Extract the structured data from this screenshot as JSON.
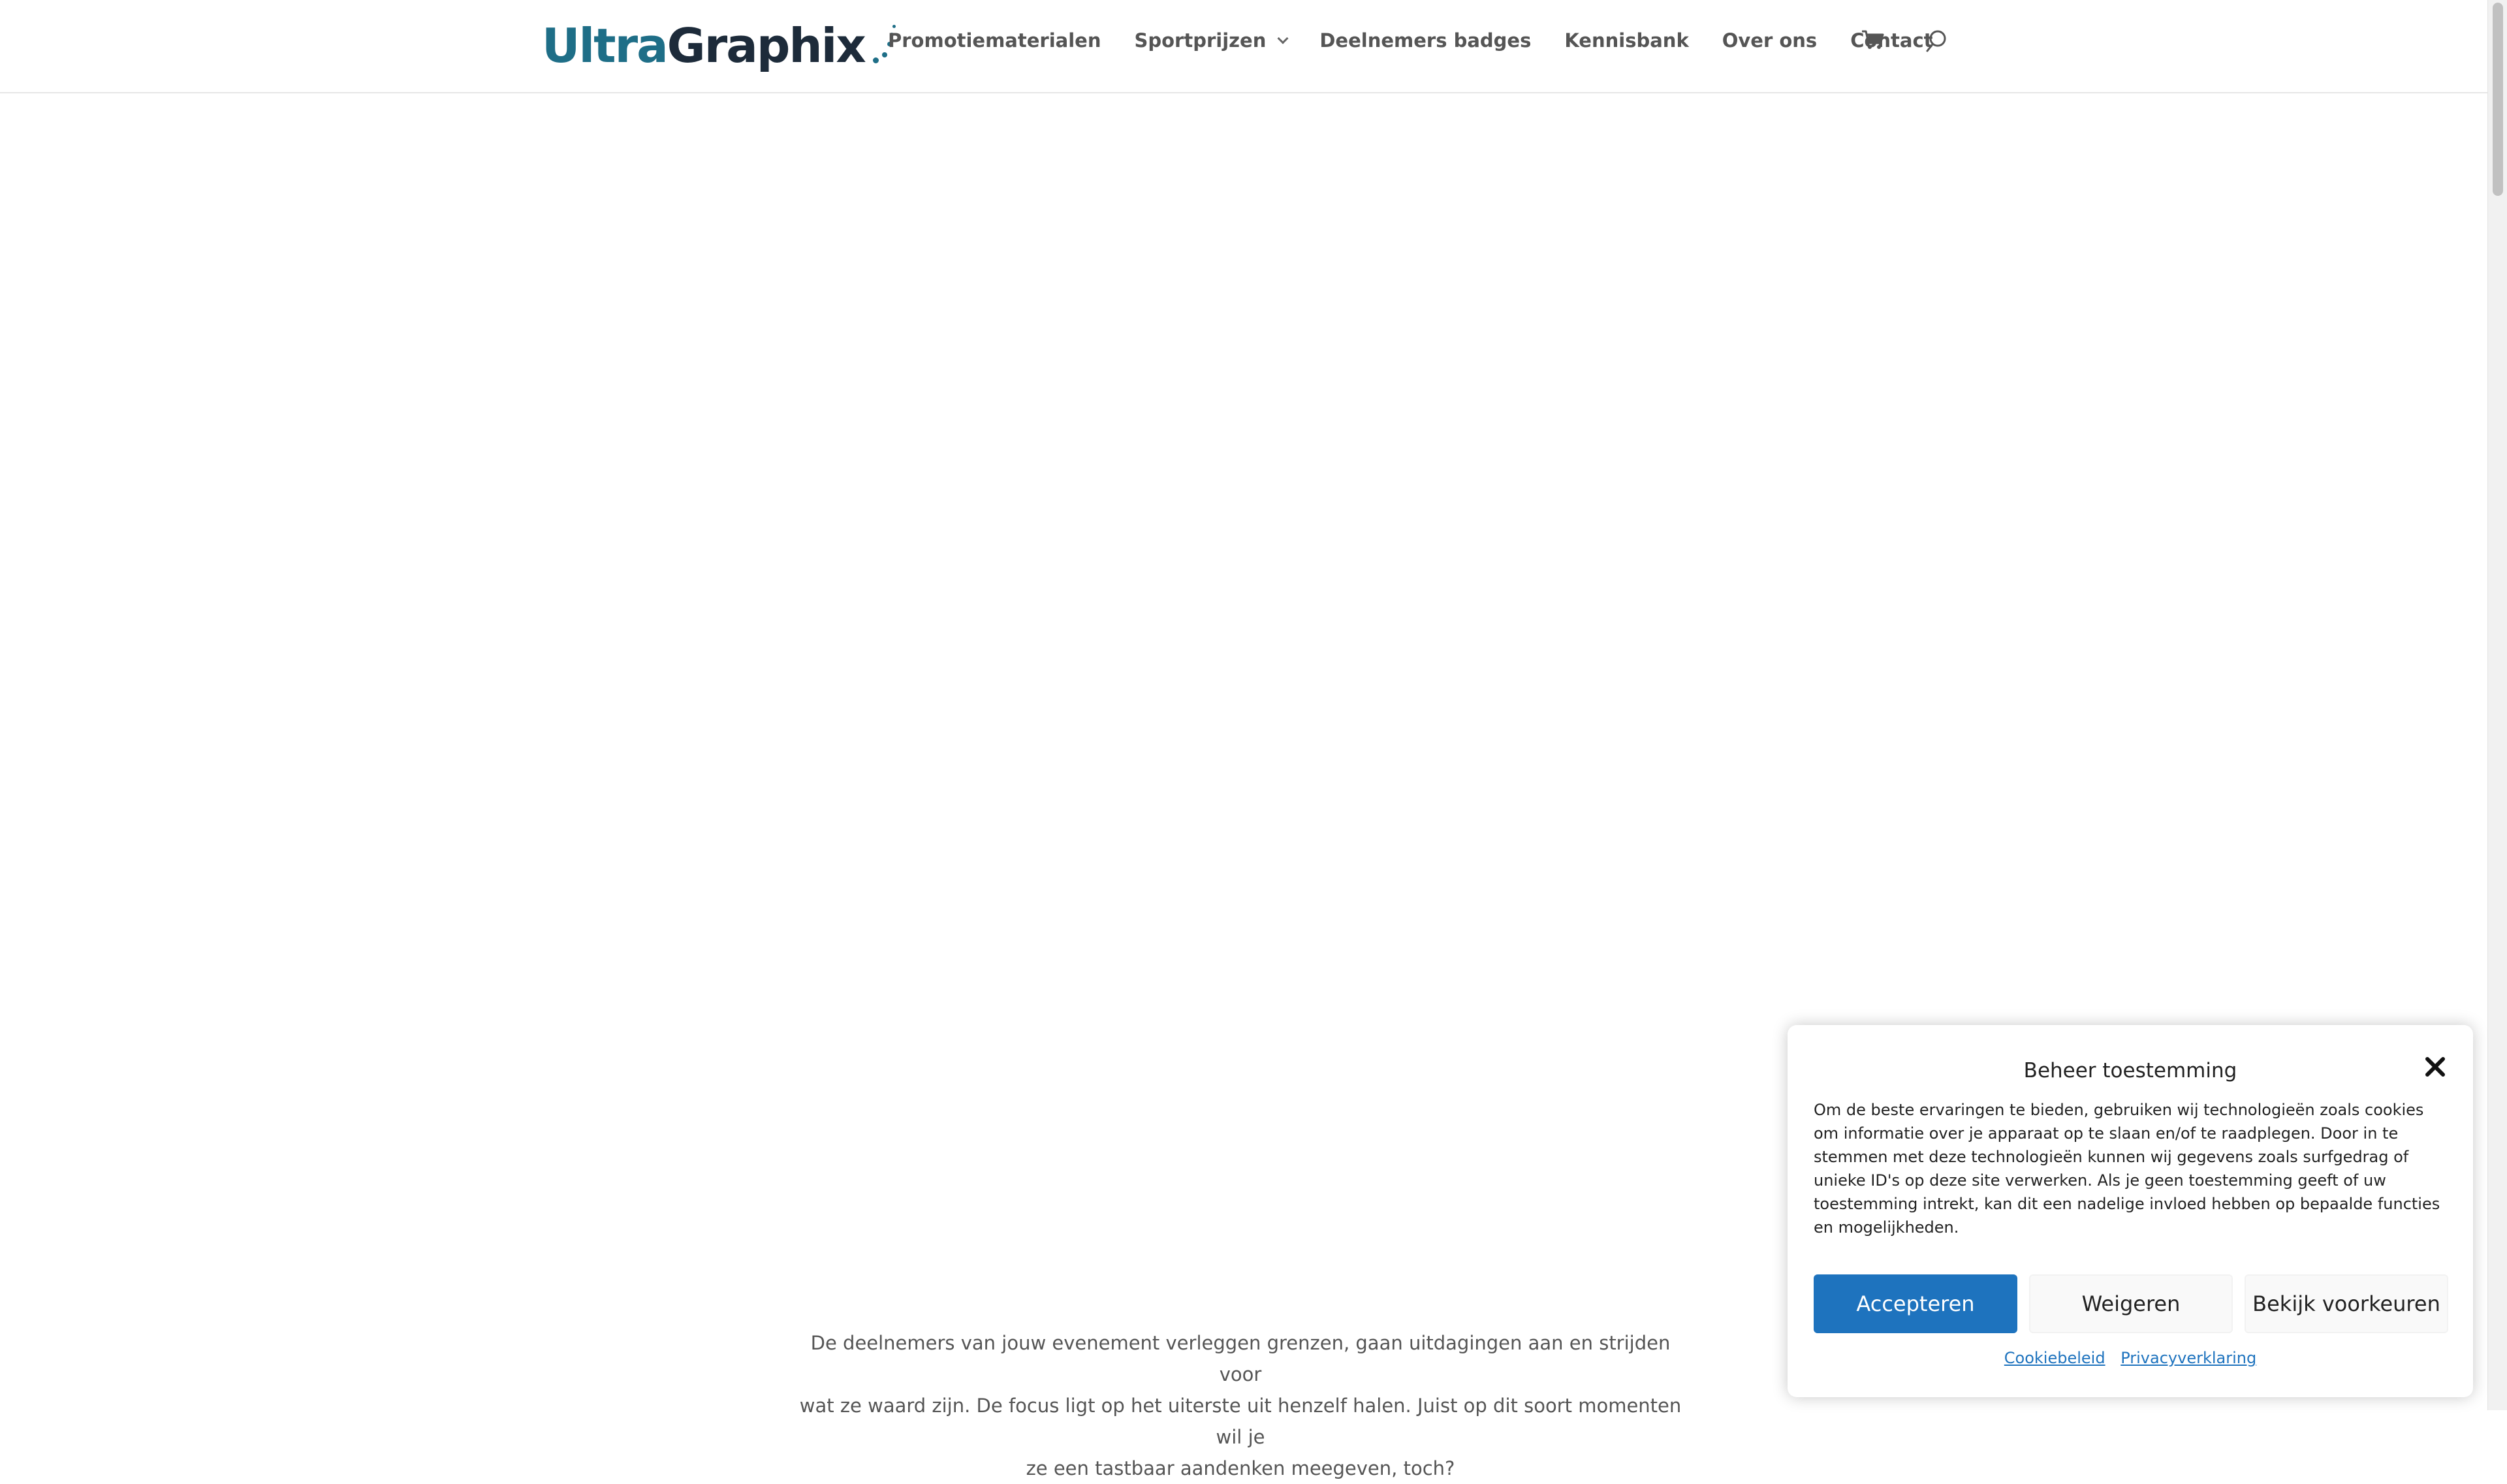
{
  "header": {
    "logo_part1": "Ultra",
    "logo_part2": "Graphix",
    "nav": [
      {
        "label": "Promotiematerialen"
      },
      {
        "label": "Sportprijzen",
        "has_dropdown": true
      },
      {
        "label": "Deelnemers badges"
      },
      {
        "label": "Kennisbank"
      },
      {
        "label": "Over ons"
      },
      {
        "label": "Contact"
      }
    ],
    "icons": [
      "cart-icon",
      "search-icon"
    ]
  },
  "main": {
    "intro_line1": "De deelnemers van jouw evenement verleggen grenzen, gaan uitdagingen aan en strijden voor",
    "intro_line2": "wat ze waard zijn. De focus ligt op het uiterste uit henzelf halen. Juist op dit soort momenten wil je",
    "intro_line3": "ze een tastbaar aandenken meegeven, toch?"
  },
  "cookie_dialog": {
    "title": "Beheer toestemming",
    "text": "Om de beste ervaringen te bieden, gebruiken wij technologieën zoals cookies om informatie over je apparaat op te slaan en/of te raadplegen. Door in te stemmen met deze technologieën kunnen wij gegevens zoals surfgedrag of unieke ID's op deze site verwerken. Als je geen toestemming geeft of uw toestemming intrekt, kan dit een nadelige invloed hebben op bepaalde functies en mogelijkheden.",
    "accept_label": "Accepteren",
    "deny_label": "Weigeren",
    "prefs_label": "Bekijk voorkeuren",
    "link_cookie_policy": "Cookiebeleid",
    "link_privacy": "Privacyverklaring"
  },
  "colors": {
    "brand_teal": "#1e6e87",
    "brand_dark": "#1d2b3a",
    "accept_blue": "#1e73be",
    "nav_text": "#555555"
  }
}
